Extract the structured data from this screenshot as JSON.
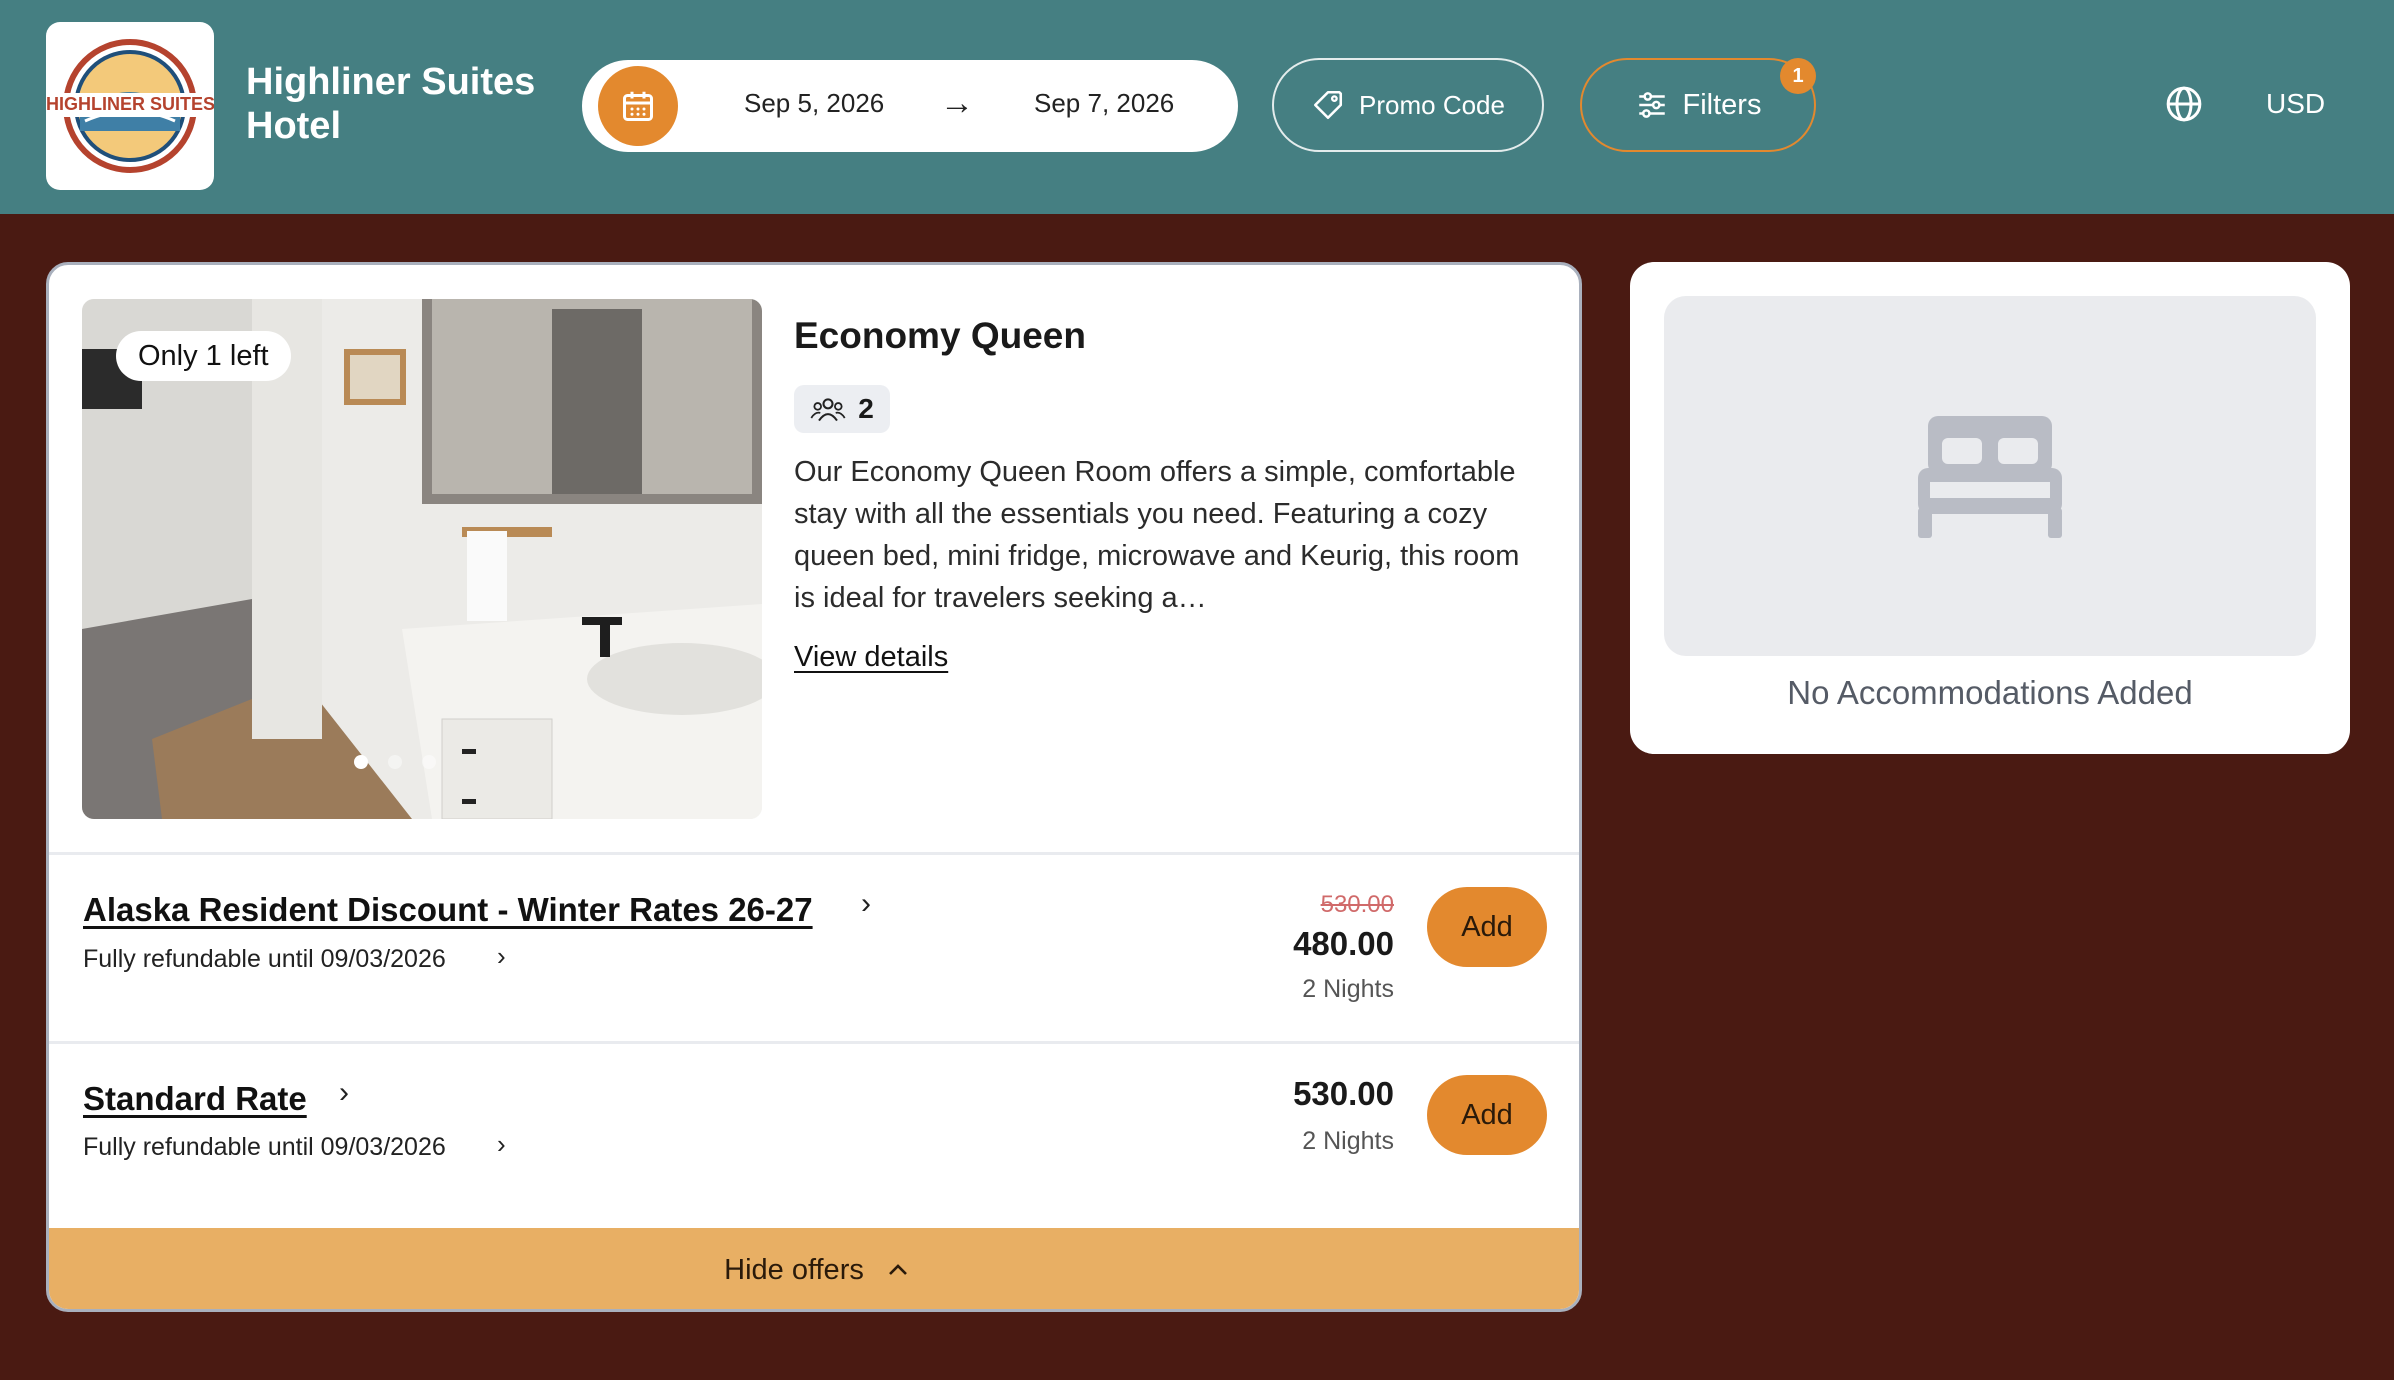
{
  "header": {
    "logo_text": "HIGHLINER SUITES HOTEL",
    "hotel_name": "Highliner Suites Hotel",
    "check_in": "Sep 5, 2026",
    "check_out": "Sep 7, 2026",
    "promo_label": "Promo Code",
    "filters_label": "Filters",
    "filters_count": "1",
    "currency": "USD",
    "accent_color": "#e3892e",
    "header_color": "#457f82"
  },
  "room": {
    "availability_badge": "Only 1 left",
    "title": "Economy Queen",
    "guests": "2",
    "description": "Our Economy Queen Room offers a simple, comfortable stay with all the essentials you need. Featuring a cozy queen bed, mini fridge, microwave and Keurig, this room is ideal for travelers seeking a…",
    "view_details": "View details",
    "photo_count": 3,
    "photo_active_index": 0
  },
  "offers": [
    {
      "name": "Alaska Resident Discount - Winter Rates 26-27",
      "refund": "Fully refundable until 09/03/2026",
      "old_price": "530.00",
      "price": "480.00",
      "nights": "2 Nights",
      "button": "Add"
    },
    {
      "name": "Standard Rate",
      "refund": "Fully refundable until 09/03/2026",
      "price": "530.00",
      "nights": "2 Nights",
      "button": "Add"
    }
  ],
  "hide_offers_label": "Hide offers",
  "cart": {
    "empty_message": "No Accommodations Added"
  }
}
